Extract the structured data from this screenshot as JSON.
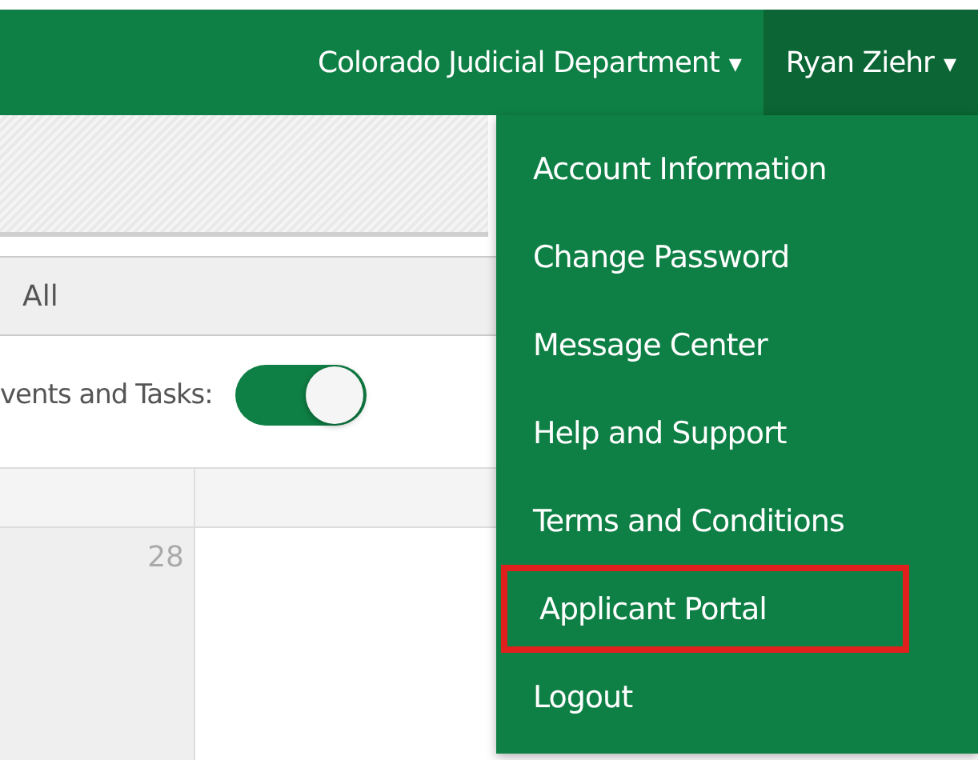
{
  "navbar": {
    "organization": {
      "label": "Colorado Judicial Department",
      "caret": "▾"
    },
    "user": {
      "label": "Ryan Ziehr",
      "caret": "▾",
      "expanded": true
    }
  },
  "filter": {
    "value": "All"
  },
  "toggle": {
    "label": "vents and Tasks:",
    "on": true
  },
  "calendar": {
    "day": "28"
  },
  "user_menu": [
    {
      "label": "Account Information",
      "highlighted": false
    },
    {
      "label": "Change Password",
      "highlighted": false
    },
    {
      "label": "Message Center",
      "highlighted": false
    },
    {
      "label": "Help and Support",
      "highlighted": false
    },
    {
      "label": "Terms and Conditions",
      "highlighted": false
    },
    {
      "label": "Applicant Portal",
      "highlighted": true
    },
    {
      "label": "Logout",
      "highlighted": false
    }
  ]
}
